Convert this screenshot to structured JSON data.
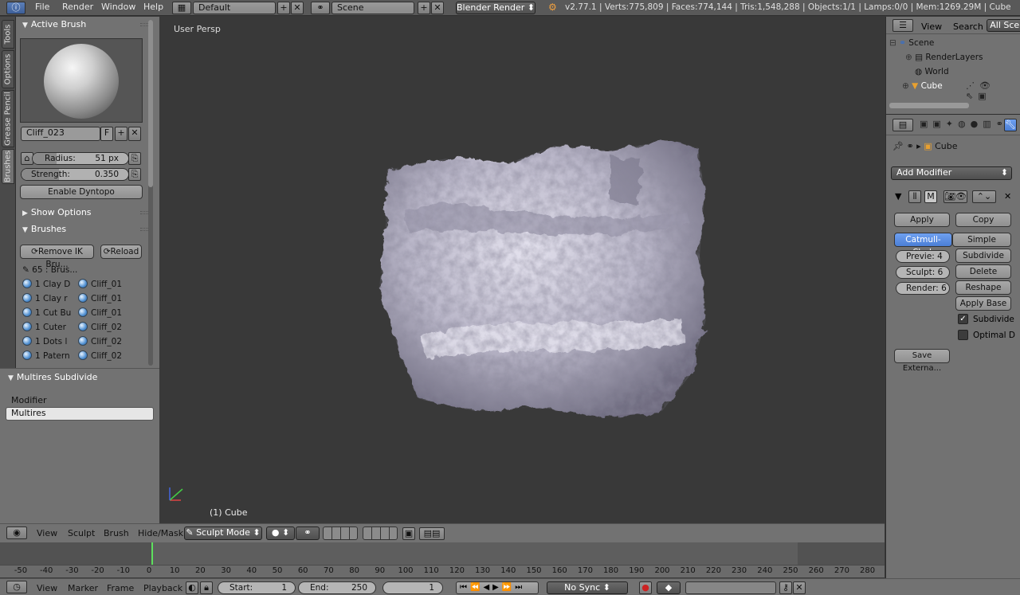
{
  "menubar": {
    "items": [
      "File",
      "Render",
      "Window",
      "Help"
    ],
    "layout": "Default",
    "scene": "Scene",
    "engine": "Blender Render",
    "stats": "v2.77.1 | Verts:775,809 | Faces:774,144 | Tris:1,548,288 | Objects:1/1 | Lamps:0/0 | Mem:1269.29M | Cube"
  },
  "shelf": {
    "tabs": [
      "Tools",
      "Options",
      "Grease Pencil",
      "Brushes"
    ],
    "active_brush_title": "Active Brush",
    "brush_name": "Cliff_023",
    "fake_user": "F",
    "radius": {
      "label": "Radius:",
      "value": "51 px",
      "fraction": 0.25
    },
    "strength": {
      "label": "Strength:",
      "value": "0.350",
      "fraction": 0.35
    },
    "dyntopo_btn": "Enable Dyntopo",
    "show_options": "Show Options",
    "brushes_title": "Brushes",
    "remove_btn": "Remove IK Bru...",
    "reload_btn": "Reload",
    "brush_count": "65 : Brus...",
    "brush_list_left": [
      "1 Clay D",
      "1 Clay r",
      "1 Cut Bu",
      "1 Cuter",
      "1 Dots l",
      "1 Patern"
    ],
    "brush_list_right": [
      "Cliff_01",
      "Cliff_01",
      "Cliff_01",
      "Cliff_02",
      "Cliff_02",
      "Cliff_02"
    ]
  },
  "operator": {
    "title": "Multires Subdivide",
    "modifier_label": "Modifier",
    "modifier_value": "Multires"
  },
  "viewport": {
    "title": "User Persp",
    "object_label": "(1) Cube"
  },
  "viewport_header": {
    "menus": [
      "View",
      "Sculpt",
      "Brush",
      "Hide/Mask"
    ],
    "mode": "Sculpt Mode"
  },
  "timeline": {
    "ticks": [
      "-50",
      "-40",
      "-30",
      "-20",
      "-10",
      "0",
      "10",
      "20",
      "30",
      "40",
      "50",
      "60",
      "70",
      "80",
      "90",
      "100",
      "110",
      "120",
      "130",
      "140",
      "150",
      "160",
      "170",
      "180",
      "190",
      "200",
      "210",
      "220",
      "230",
      "240",
      "250",
      "260",
      "270",
      "280"
    ],
    "menus": [
      "View",
      "Marker",
      "Frame",
      "Playback"
    ],
    "start_label": "Start:",
    "start_value": "1",
    "end_label": "End:",
    "end_value": "250",
    "current": "1",
    "sync": "No Sync"
  },
  "outliner": {
    "view": "View",
    "search": "Search",
    "filter": "All Scer",
    "tree": [
      "Scene",
      "RenderLayers",
      "World",
      "Cube"
    ]
  },
  "properties": {
    "context_object": "Cube",
    "add_modifier": "Add Modifier",
    "apply": "Apply",
    "copy": "Copy",
    "catmull": "Catmull-Clark",
    "simple": "Simple",
    "preview": "Previe:  4",
    "sculpt": "Sculpt:  6",
    "render": "Render: 6",
    "subdivide": "Subdivide",
    "delete_higher": "Delete Higher",
    "reshape": "Reshape",
    "apply_base": "Apply Base",
    "subdivide_uvs": "Subdivide",
    "optimal": "Optimal D",
    "save_external": "Save Externa..."
  }
}
